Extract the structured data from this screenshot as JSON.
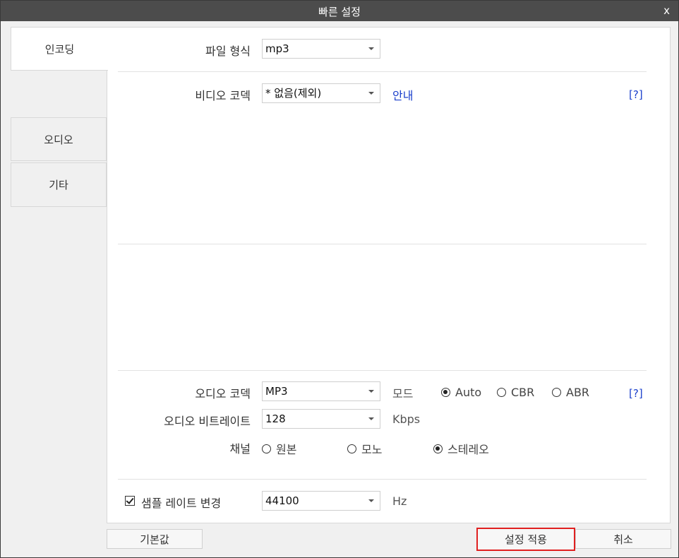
{
  "window": {
    "title": "빠른 설정",
    "close_label": "x"
  },
  "sidebar": {
    "items": [
      {
        "label": "인코딩",
        "active": true
      },
      {
        "label": "오디오",
        "active": false
      },
      {
        "label": "기타",
        "active": false
      }
    ]
  },
  "file_format": {
    "label": "파일 형식",
    "value": "mp3"
  },
  "video_codec": {
    "label": "비디오 코덱",
    "value": "* 없음(제외)",
    "guide_link": "안내",
    "help": "[?]"
  },
  "audio_codec": {
    "label": "오디오 코덱",
    "value": "MP3",
    "mode_label": "모드",
    "help": "[?]",
    "modes": [
      {
        "label": "Auto",
        "selected": true
      },
      {
        "label": "CBR",
        "selected": false
      },
      {
        "label": "ABR",
        "selected": false
      }
    ]
  },
  "audio_bitrate": {
    "label": "오디오 비트레이트",
    "value": "128",
    "unit": "Kbps"
  },
  "channel": {
    "label": "채널",
    "options": [
      {
        "label": "원본",
        "selected": false
      },
      {
        "label": "모노",
        "selected": false
      },
      {
        "label": "스테레오",
        "selected": true
      }
    ]
  },
  "sample_rate": {
    "checkbox_label": "샘플 레이트 변경",
    "checked": true,
    "value": "44100",
    "unit": "Hz"
  },
  "buttons": {
    "default": "기본값",
    "apply": "설정 적용",
    "cancel": "취소"
  }
}
